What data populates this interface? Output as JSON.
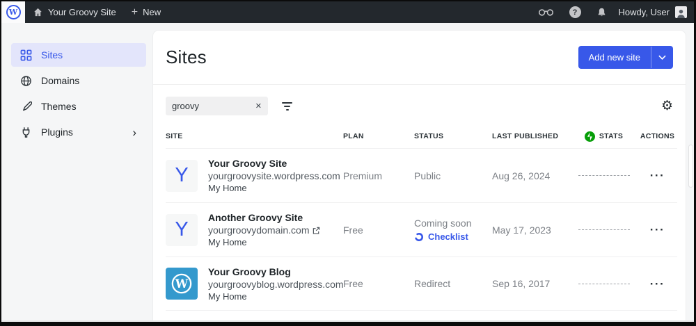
{
  "admin_bar": {
    "site_name": "Your Groovy Site",
    "new_label": "New",
    "howdy": "Howdy, User"
  },
  "sidebar": {
    "items": [
      {
        "label": "Sites",
        "selected": true
      },
      {
        "label": "Domains",
        "selected": false
      },
      {
        "label": "Themes",
        "selected": false
      },
      {
        "label": "Plugins",
        "selected": false,
        "has_submenu": true
      }
    ]
  },
  "main": {
    "title": "Sites",
    "add_button_label": "Add new site",
    "search": {
      "value": "groovy"
    },
    "table": {
      "headers": [
        "SITE",
        "PLAN",
        "STATUS",
        "LAST PUBLISHED",
        "STATS",
        "ACTIONS"
      ],
      "rows": [
        {
          "title": "Your Groovy Site",
          "url": "yourgroovysite.wordpress.com",
          "home_link": "My Home",
          "plan": "Premium",
          "status": "Public",
          "last_published": "Aug 26, 2024",
          "icon_letter": "Y"
        },
        {
          "title": "Another Groovy Site",
          "url": "yourgroovydomain.com",
          "home_link": "My Home",
          "plan": "Free",
          "status": "Coming soon",
          "checklist_label": "Checklist",
          "last_published": "May 17, 2023",
          "icon_letter": "Y"
        },
        {
          "title": "Your Groovy Blog",
          "url": "yourgroovyblog.wordpress.com",
          "home_link": "My Home",
          "plan": "Free",
          "status": "Redirect",
          "last_published": "Sep 16, 2017",
          "icon_type": "wordpress-logo"
        }
      ]
    }
  },
  "icons": {
    "wp_logo_letter": "W",
    "plus": "+",
    "help": "?",
    "actions_menu": "···",
    "settings_gear": "⚙",
    "clear_search": "✕",
    "submenu_chevron": "›"
  },
  "colors": {
    "accent_blue": "#3858e9",
    "jetpack_green": "#069e08",
    "blavatar_blue": "#3499cd",
    "admin_bar_bg": "#23282d",
    "selected_item_bg": "#e3e5fb"
  }
}
